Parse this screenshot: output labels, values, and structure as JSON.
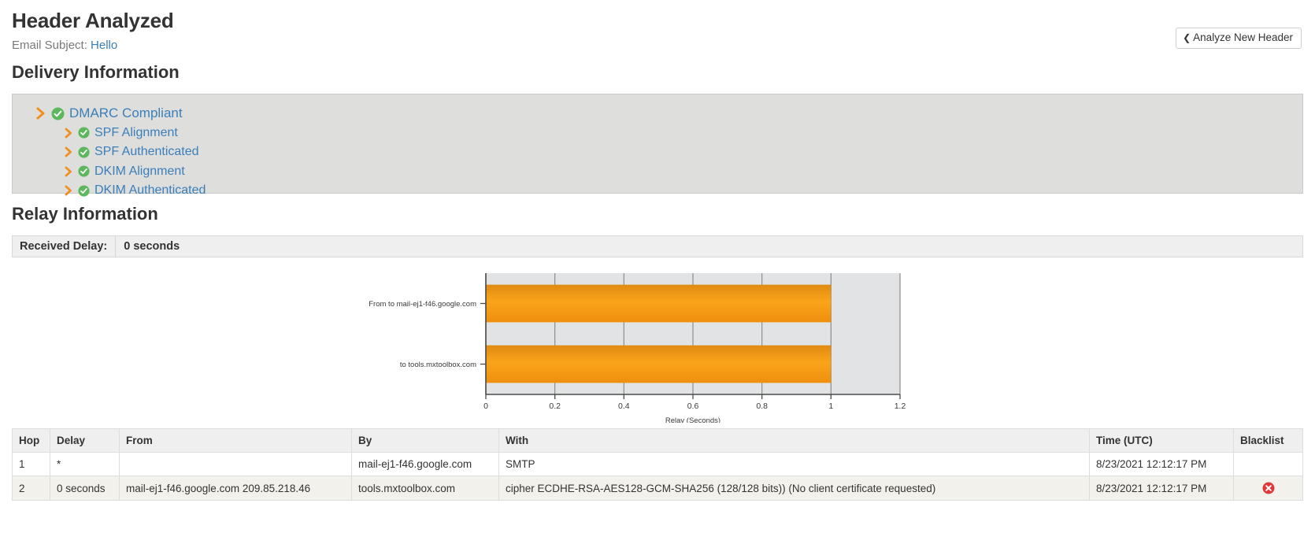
{
  "header": {
    "title": "Header Analyzed",
    "subject_label": "Email Subject:",
    "subject_value": "Hello",
    "analyze_button": "Analyze New Header",
    "back_chevron": "‹"
  },
  "delivery": {
    "section_title": "Delivery Information",
    "items": [
      {
        "label": "DMARC Compliant",
        "level": 1,
        "status": "pass"
      },
      {
        "label": "SPF Alignment",
        "level": 2,
        "status": "pass"
      },
      {
        "label": "SPF Authenticated",
        "level": 2,
        "status": "pass"
      },
      {
        "label": "DKIM Alignment",
        "level": 2,
        "status": "pass"
      },
      {
        "label": "DKIM Authenticated",
        "level": 2,
        "status": "pass"
      }
    ]
  },
  "relay": {
    "section_title": "Relay Information",
    "received_delay_label": "Received Delay:",
    "received_delay_value": "0 seconds"
  },
  "chart_data": {
    "type": "bar",
    "orientation": "horizontal",
    "title": "",
    "xlabel": "Relay (Seconds)",
    "ylabel": "",
    "categories": [
      "From  to mail-ej1-f46.google.com",
      "to tools.mxtoolbox.com"
    ],
    "values": [
      1,
      1
    ],
    "xlim": [
      0,
      1.2
    ],
    "xticks": [
      0,
      0.2,
      0.4,
      0.6,
      0.8,
      1,
      1.2
    ],
    "xticklabels": [
      "0",
      "0.2",
      "0.4",
      "0.6",
      "0.8",
      "1",
      "1.2"
    ],
    "grid": true,
    "legend": false,
    "bar_color": "#F59B14",
    "plot_bg": "#e2e3e4"
  },
  "table": {
    "columns": [
      "Hop",
      "Delay",
      "From",
      "By",
      "With",
      "Time (UTC)",
      "Blacklist"
    ],
    "rows": [
      {
        "hop": "1",
        "delay": "*",
        "from": "",
        "by": "mail-ej1-f46.google.com",
        "with": "SMTP",
        "time": "8/23/2021 12:12:17 PM",
        "blacklist": false
      },
      {
        "hop": "2",
        "delay": "0 seconds",
        "from": "mail-ej1-f46.google.com 209.85.218.46",
        "by": "tools.mxtoolbox.com",
        "with": "cipher ECDHE-RSA-AES128-GCM-SHA256 (128/128 bits)) (No client certificate requested)",
        "time": "8/23/2021 12:12:17 PM",
        "blacklist": true
      }
    ]
  },
  "colors": {
    "link": "#3b7fb8",
    "chevron_orange": "#ef8f1f",
    "check_green": "#5cb85c",
    "blacklist_red": "#dd3b3b",
    "panel_bg": "#dededd"
  }
}
